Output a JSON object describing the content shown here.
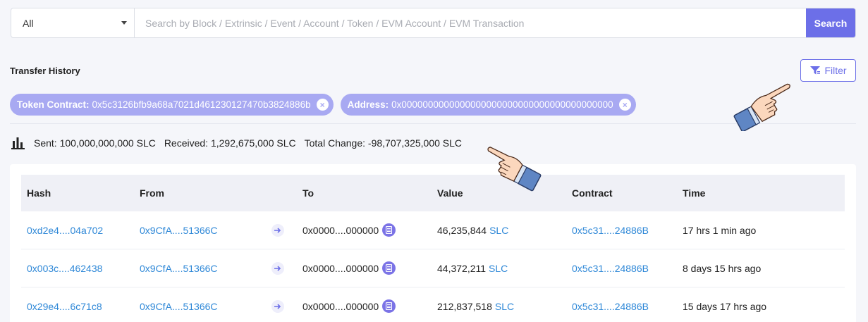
{
  "search": {
    "select_value": "All",
    "placeholder": "Search by Block / Extrinsic / Event / Account / Token / EVM Account / EVM Transaction",
    "button_label": "Search"
  },
  "section": {
    "title": "Transfer History",
    "filter_label": "Filter"
  },
  "chips": [
    {
      "key": "Token Contract:",
      "value": "0x5c3126bfb9a68a7021d461230127470b3824886b"
    },
    {
      "key": "Address:",
      "value": "0x0000000000000000000000000000000000000000"
    }
  ],
  "stats": {
    "sent": "Sent: 100,000,000,000 SLC",
    "received": "Received: 1,292,675,000 SLC",
    "total_change": "Total Change: -98,707,325,000 SLC"
  },
  "table": {
    "headers": [
      "Hash",
      "From",
      "To",
      "Value",
      "Contract",
      "Time"
    ],
    "rows": [
      {
        "hash": "0xd2e4....04a702",
        "from": "0x9CfA....51366C",
        "to": "0x0000....000000",
        "value": "46,235,844",
        "unit": "SLC",
        "contract": "0x5c31....24886B",
        "time": "17 hrs 1 min ago"
      },
      {
        "hash": "0x003c....462438",
        "from": "0x9CfA....51366C",
        "to": "0x0000....000000",
        "value": "44,372,211",
        "unit": "SLC",
        "contract": "0x5c31....24886B",
        "time": "8 days 15 hrs ago"
      },
      {
        "hash": "0x29e4....6c71c8",
        "from": "0x9CfA....51366C",
        "to": "0x0000....000000",
        "value": "212,837,518",
        "unit": "SLC",
        "contract": "0x5c31....24886B",
        "time": "15 days 17 hrs ago"
      }
    ]
  },
  "colors": {
    "accent": "#6c6fe8",
    "chip_bg": "#a8a9f2",
    "link": "#2d87d7",
    "header_bg": "#eff0f6"
  },
  "icons": [
    "chevron-down-icon",
    "filter-icon",
    "close-icon",
    "bar-chart-icon",
    "arrow-right-icon",
    "document-icon",
    "pointing-hand-icon"
  ]
}
